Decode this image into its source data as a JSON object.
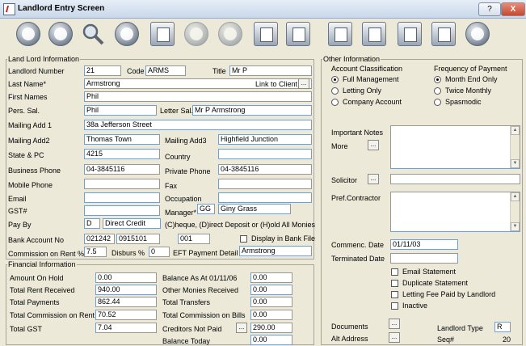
{
  "window": {
    "title": "Landlord Entry Screen",
    "help_label": "?",
    "close_label": "X"
  },
  "toolbar_icons": [
    "first-record-icon",
    "previous-record-icon",
    "search-icon",
    "next-record-icon",
    "edit-icon",
    "save-icon",
    "cancel-icon",
    "print-icon",
    "exit-icon",
    "statement-icon",
    "document-icon",
    "calendar-icon",
    "home-icon",
    "contacts-icon"
  ],
  "landlord": {
    "legend": "Land Lord Information",
    "number_label": "Landlord Number",
    "number": "21",
    "code_label": "Code",
    "code": "ARMS",
    "title_label": "Title",
    "title": "Mr P",
    "last_name_label": "Last Name*",
    "last_name": "Armstrong",
    "link_label": "Link to Client",
    "first_names_label": "First Names",
    "first_names": "Phil",
    "pers_sal_label": "Pers. Sal.",
    "pers_sal": "Phil",
    "letter_sal_label": "Letter Sal.",
    "letter_sal": "Mr P Armstrong",
    "add1_label": "Mailing Add 1",
    "add1": "38a Jefferson Street",
    "add2_label": "Mailing Add2",
    "add2": "Thomas Town",
    "add3_label": "Mailing Add3",
    "add3": "Highfield Junction",
    "state_label": "State & PC",
    "state": "4215",
    "country_label": "Country",
    "country": "",
    "business_label": "Business Phone",
    "business": "04-3845116",
    "private_label": "Private Phone",
    "private": "04-3845116",
    "mobile_label": "Mobile Phone",
    "mobile": "",
    "fax_label": "Fax",
    "fax": "",
    "email_label": "Email",
    "email": "",
    "occupation_label": "Occupation",
    "occupation": "",
    "gst_label": "GST#",
    "gst": "",
    "manager_label": "Manager*",
    "manager_code": "GG",
    "manager_name": "Giny Grass",
    "payby_label": "Pay By",
    "payby_code": "D",
    "payby_text": "Direct Credit",
    "payby_hint": "(C)heque, (D)irect Deposit or (H)old All Monies",
    "bank_label": "Bank Account No",
    "bank1": "021242",
    "bank2": "0915101",
    "bank3": "001",
    "display_bank_label": "Display in Bank File",
    "commission_label": "Commission on Rent %",
    "commission": "7.5",
    "disburs_label": "Disburs %",
    "disburs": "0",
    "eft_label": "EFT Payment Detail",
    "eft": "Armstrong"
  },
  "financial": {
    "legend": "Financial Information",
    "amount_hold_label": "Amount On Hold",
    "amount_hold": "0.00",
    "total_rent_label": "Total Rent Received",
    "total_rent": "940.00",
    "total_payments_label": "Total Payments",
    "total_payments": "862.44",
    "total_comm_label": "Total Commission on Rent",
    "total_comm": "70.52",
    "total_gst_label": "Total GST",
    "total_gst": "7.04",
    "balance_as_at_label": "Balance As At 01/11/06",
    "balance_as_at": "0.00",
    "other_monies_label": "Other Monies Received",
    "other_monies": "0.00",
    "total_transfers_label": "Total Transfers",
    "total_transfers": "0.00",
    "comm_bills_label": "Total Commission on Bills",
    "comm_bills": "0.00",
    "creditors_label": "Creditors Not Paid",
    "creditors": "290.00",
    "balance_today_label": "Balance Today",
    "balance_today": "0.00"
  },
  "other": {
    "legend": "Other Information",
    "class_label": "Account Classification",
    "class_options": [
      "Full Management",
      "Letting Only",
      "Company Account"
    ],
    "freq_label": "Frequency of Payment",
    "freq_options": [
      "Month End Only",
      "Twice Monthly",
      "Spasmodic"
    ],
    "notes_label": "Important Notes",
    "more_label": "More",
    "solicitor_label": "Solicitor",
    "contractor_label": "Pref.Contractor",
    "commenc_label": "Commenc. Date",
    "commenc": "01/11/03",
    "terminated_label": "Terminated Date",
    "terminated": "",
    "checks": [
      "Email Statement",
      "Duplicate Statement",
      "Letting Fee Paid by Landlord",
      "Inactive"
    ],
    "documents_label": "Documents",
    "alt_address_label": "Alt Address",
    "landlord_type_label": "Landlord Type",
    "landlord_type": "R",
    "seq_label": "Seq#",
    "seq": "20",
    "ellipsis": "..."
  }
}
